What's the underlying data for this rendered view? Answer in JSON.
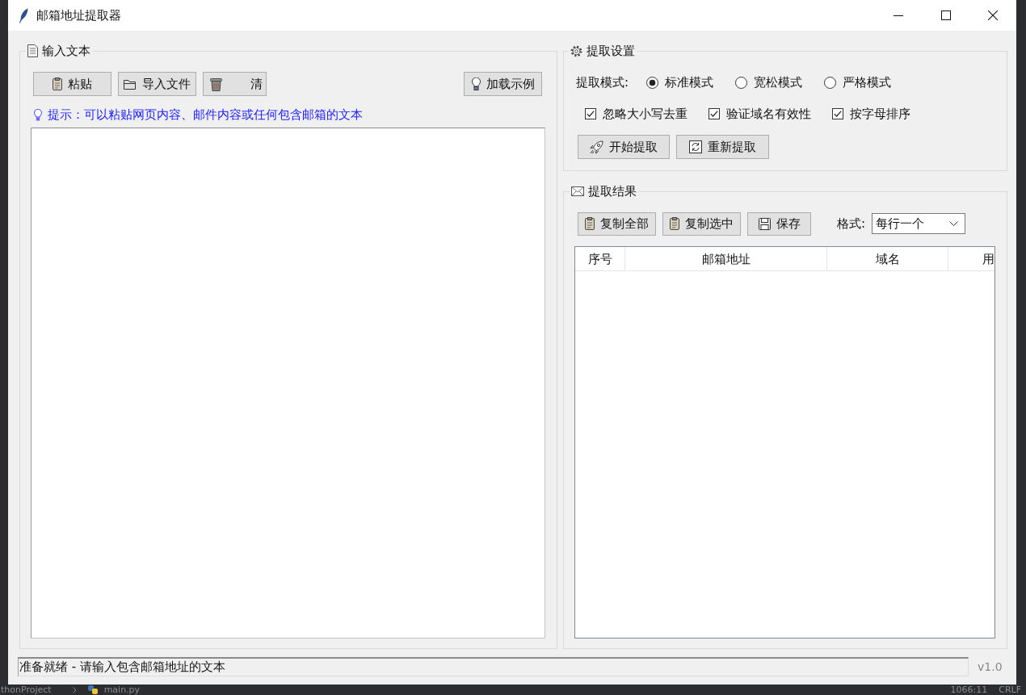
{
  "window": {
    "title": "邮箱地址提取器"
  },
  "input_panel": {
    "title": "输入文本",
    "buttons": [
      "粘贴",
      "导入文件",
      "清",
      "加载示例"
    ],
    "hint": "提示：可以粘贴网页内容、邮件内容或任何包含邮箱的文本"
  },
  "settings_panel": {
    "title": "提取设置",
    "mode_label": "提取模式:",
    "modes": [
      {
        "label": "标准模式",
        "selected": true
      },
      {
        "label": "宽松模式",
        "selected": false
      },
      {
        "label": "严格模式",
        "selected": false
      }
    ],
    "options": [
      {
        "label": "忽略大小写去重",
        "checked": true
      },
      {
        "label": "验证域名有效性",
        "checked": true
      },
      {
        "label": "按字母排序",
        "checked": true
      }
    ],
    "buttons": [
      "开始提取",
      "重新提取"
    ]
  },
  "results_panel": {
    "title": "提取结果",
    "buttons": [
      "复制全部",
      "复制选中",
      "保存"
    ],
    "format": {
      "label": "格式:",
      "value": "每行一个"
    },
    "table": {
      "columns": [
        "序号",
        "邮箱地址",
        "域名",
        "用"
      ]
    }
  },
  "status_bar": {
    "message": "准备就绪 - 请输入包含邮箱地址的文本",
    "version": "v1.0"
  },
  "background_editor": {
    "breadcrumb": [
      "thonProject",
      "main.py"
    ],
    "cursor_position": "1066:11",
    "line_ending": "CRLF"
  }
}
